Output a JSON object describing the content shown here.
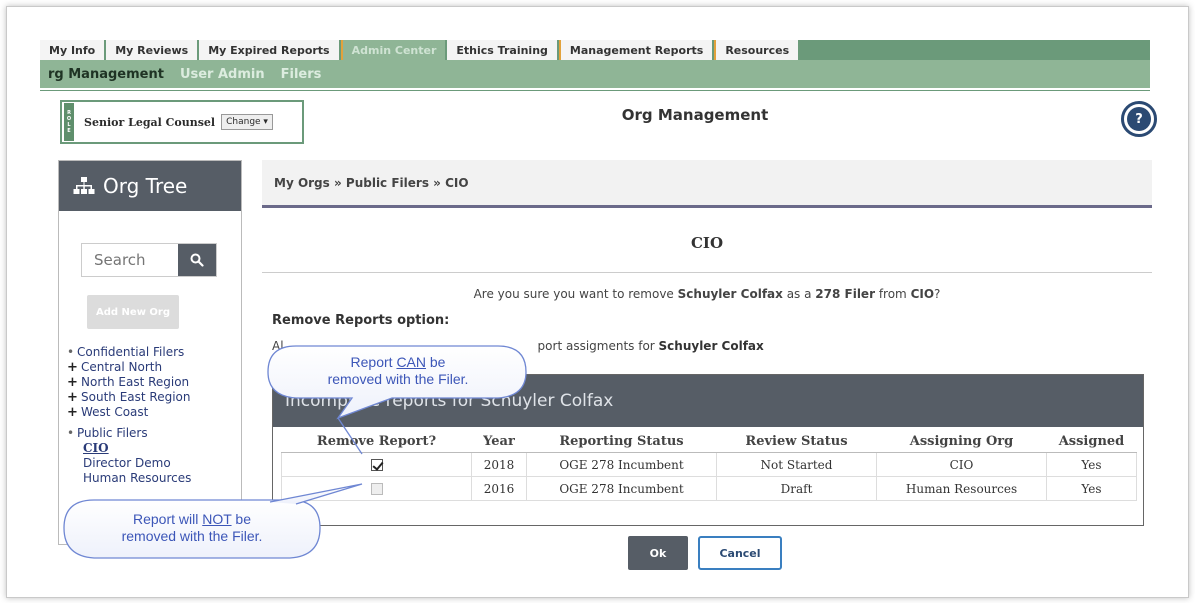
{
  "nav": {
    "tabs": [
      "My Info",
      "My Reviews",
      "My Expired Reports",
      "Admin Center",
      "Ethics Training",
      "Management Reports",
      "Resources"
    ],
    "subtabs": [
      "rg Management",
      "User Admin",
      "Filers"
    ]
  },
  "role": {
    "strip_label": "ROLE",
    "name": "Senior Legal Counsel",
    "change_label": "Change ▾"
  },
  "page_title": "Org Management",
  "help_label": "?",
  "sidebar": {
    "title": "Org Tree",
    "search_placeholder": "Search",
    "add_button": "Add New Org",
    "tree": {
      "group1": "Confidential Filers",
      "group1_children": [
        "Central North",
        "North East Region",
        "South East Region",
        "West Coast"
      ],
      "group2": "Public Filers",
      "group2_children": [
        "CIO",
        "Director Demo",
        "Human Resources"
      ]
    }
  },
  "breadcrumb": "My Orgs » Public Filers » CIO",
  "org_heading": "CIO",
  "confirm": {
    "pre": "Are you sure you want to remove ",
    "person": "Schuyler Colfax",
    "mid": " as a ",
    "role": "278 Filer",
    "from": " from ",
    "org": "CIO",
    "end": "?"
  },
  "remove_option_label": "Remove Reports option:",
  "also": {
    "pre": "Al",
    "mid": "port assigments for ",
    "person": "Schuyler Colfax"
  },
  "incomplete_header": "Incomplete reports for Schuyler Colfax",
  "table": {
    "headers": [
      "Remove Report?",
      "Year",
      "Reporting Status",
      "Review Status",
      "Assigning Org",
      "Assigned"
    ],
    "rows": [
      {
        "checked": true,
        "year": "2018",
        "reporting": "OGE 278 Incumbent",
        "review": "Not Started",
        "org": "CIO",
        "assigned": "Yes"
      },
      {
        "checked": false,
        "year": "2016",
        "reporting": "OGE 278 Incumbent",
        "review": "Draft",
        "org": "Human Resources",
        "assigned": "Yes"
      }
    ]
  },
  "buttons": {
    "ok": "Ok",
    "cancel": "Cancel"
  },
  "callouts": {
    "can": {
      "line1_pre": "Report ",
      "line1_u": "CAN",
      "line1_post": " be",
      "line2": "removed with the Filer."
    },
    "not": {
      "line1_pre": "Report will ",
      "line1_u": "NOT",
      "line1_post": " be",
      "line2": "removed with the Filer."
    }
  },
  "colors": {
    "nav_green": "#6b9a7a",
    "header_gray": "#565d66",
    "callout_blue": "#3c56b8"
  }
}
